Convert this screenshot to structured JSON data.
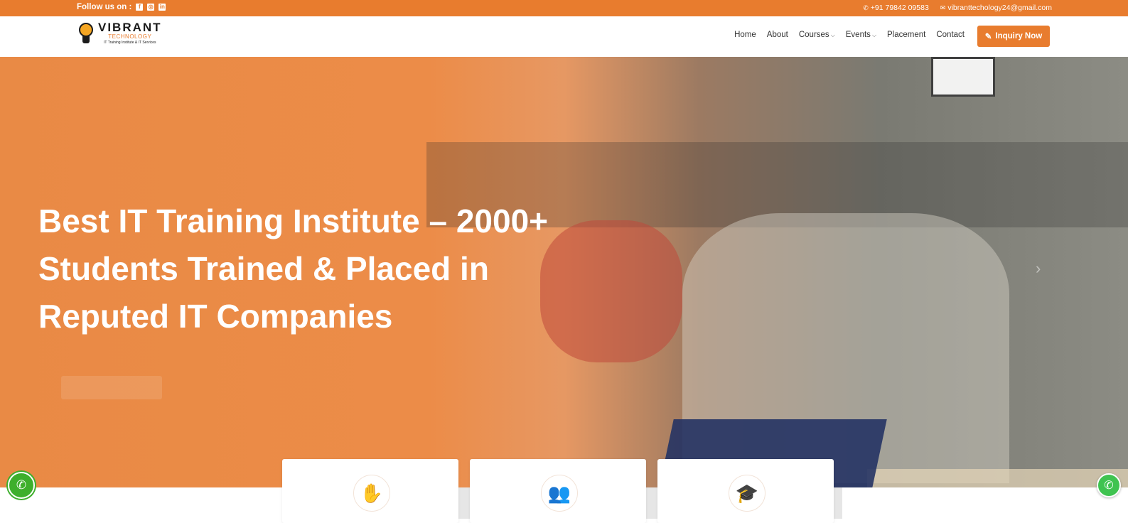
{
  "topbar": {
    "follow_label": "Follow us on :",
    "social": [
      {
        "icon": "facebook-icon",
        "glyph": "f"
      },
      {
        "icon": "instagram-icon",
        "glyph": "◎"
      },
      {
        "icon": "linkedin-icon",
        "glyph": "in"
      }
    ],
    "phone": "+91 79842 09583",
    "email": "vibranttechology24@gmail.com"
  },
  "brand": {
    "name": "VIBRANT",
    "sub": "TECHNOLOGY",
    "tagline": "IT Training Institute & IT Services"
  },
  "nav": {
    "items": [
      "Home",
      "About",
      "Courses",
      "Events",
      "Placement",
      "Contact"
    ],
    "inquiry_label": "Inquiry Now"
  },
  "hero": {
    "headline": "Best IT Training Institute – 2000+ Students Trained & Placed in Reputed IT Companies"
  },
  "cards": [
    {
      "icon": "hand-money-icon",
      "glyph": "✋"
    },
    {
      "icon": "group-people-icon",
      "glyph": "👥"
    },
    {
      "icon": "graduate-icon",
      "glyph": "🎓"
    }
  ],
  "colors": {
    "accent": "#e87c2e",
    "call": "#3eaf2c",
    "whatsapp": "#3fc350"
  }
}
